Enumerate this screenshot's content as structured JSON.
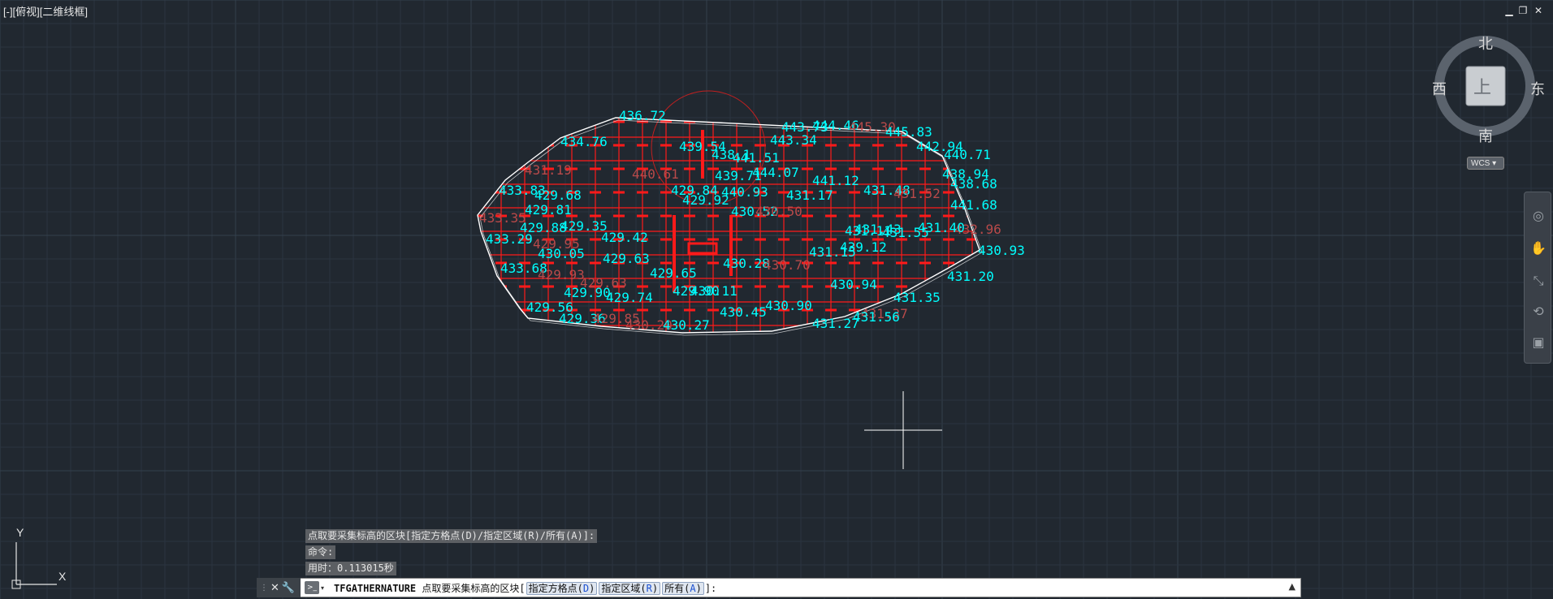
{
  "viewport": {
    "label": "[-][俯视][二维线框]",
    "window_controls": [
      "minimize-icon",
      "restore-icon",
      "close-icon"
    ]
  },
  "viewcube": {
    "north": "北",
    "south": "南",
    "east": "东",
    "west": "西",
    "face": "上",
    "wcs": "WCS"
  },
  "drawing": {
    "elevation_labels": [
      "436.72",
      "443.73",
      "444.46",
      "445.30",
      "445.83",
      "442.94",
      "440.71",
      "438.94",
      "438.68",
      "441.68",
      "432.96",
      "430.93",
      "431.20",
      "439.54",
      "443.34",
      "441.51",
      "438.1",
      "440.61",
      "439.71",
      "444.07",
      "440.93",
      "431.17",
      "441.12",
      "431.48",
      "431.52",
      "431.43",
      "431.55",
      "431.40",
      "429.84",
      "429.92",
      "430.52",
      "430.50",
      "429.42",
      "429.63",
      "439.12",
      "431.15",
      "431.11",
      "430.28",
      "430.70",
      "429.65",
      "430.11",
      "430.45",
      "429.90",
      "430.94",
      "431.35",
      "431.37",
      "430.90",
      "434.76",
      "433.68",
      "433.29",
      "433.35",
      "433.83",
      "431.19",
      "429.68",
      "429.81",
      "429.95",
      "429.88",
      "430.05",
      "429.35",
      "429.93",
      "429.63",
      "429.74",
      "429.90",
      "429.56",
      "429.36",
      "429.85",
      "430.20",
      "430.27",
      "431.27",
      "431.56"
    ]
  },
  "command": {
    "history": [
      "点取要采集标高的区块[指定方格点(D)/指定区域(R)/所有(A)]:",
      "命令:",
      "用时：0.113015秒"
    ],
    "command_name": "TFGATHERNATURE",
    "prompt": "点取要采集标高的区块",
    "options": [
      {
        "label": "指定方格点",
        "key": "D"
      },
      {
        "label": "指定区域",
        "key": "R"
      },
      {
        "label": "所有",
        "key": "A"
      }
    ],
    "suffix": "]:",
    "prompt_icon": ">_"
  },
  "ucs": {
    "x_axis": "X",
    "y_axis": "Y"
  },
  "colors": {
    "background": "#212830",
    "grid_line": "#2b3440",
    "grid_major": "#34404d",
    "boundary": "#ffffff",
    "grid_red": "#ff1a1a",
    "label_cyan": "#00ffff",
    "label_dim": "#b84a4a"
  }
}
